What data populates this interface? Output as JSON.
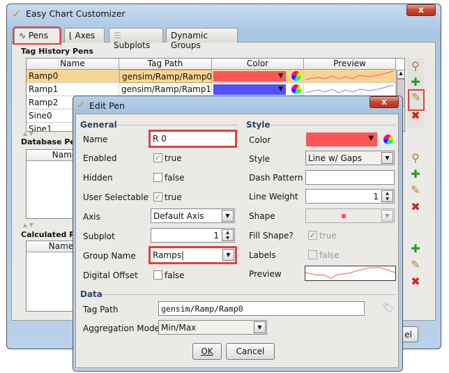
{
  "main": {
    "title": "Easy Chart Customizer",
    "close": "x",
    "tabs": [
      {
        "label": "Pens",
        "icon": "line-chart-icon"
      },
      {
        "label": "Axes",
        "icon": "axes-icon"
      },
      {
        "label": "Subplots",
        "icon": "subplots-icon"
      },
      {
        "label": "Dynamic Groups"
      }
    ],
    "tag_history": {
      "title": "Tag History Pens",
      "columns": [
        "Name",
        "Tag Path",
        "Color",
        "Preview"
      ],
      "rows": [
        {
          "name": "Ramp0",
          "path": "gensim/Ramp/Ramp0",
          "color": "#ff5555"
        },
        {
          "name": "Ramp1",
          "path": "gensim/Ramp/Ramp1",
          "color": "#5050ff"
        },
        {
          "name": "Ramp2"
        },
        {
          "name": "Sine0"
        },
        {
          "name": "Sine1"
        }
      ]
    },
    "database": {
      "title": "Database Pens",
      "columns": [
        "Name"
      ]
    },
    "calculated": {
      "title": "Calculated Pens",
      "columns": [
        "Name"
      ]
    },
    "cancel_partial": "el"
  },
  "dialog": {
    "title": "Edit Pen",
    "close": "x",
    "general": {
      "title": "General",
      "name_label": "Name",
      "name_value": "R 0",
      "enabled_label": "Enabled",
      "enabled_value": "true",
      "enabled": true,
      "hidden_label": "Hidden",
      "hidden_value": "false",
      "hidden": false,
      "selectable_label": "User Selectable",
      "selectable_value": "true",
      "selectable": true,
      "axis_label": "Axis",
      "axis_value": "Default Axis",
      "subplot_label": "Subplot",
      "subplot_value": "1",
      "group_label": "Group Name",
      "group_value": "Ramps",
      "digital_label": "Digital Offset",
      "digital_value": "false",
      "digital": false
    },
    "style": {
      "title": "Style",
      "color_label": "Color",
      "color_value": "#ff5555",
      "style_label": "Style",
      "style_value": "Line w/ Gaps",
      "dash_label": "Dash Pattern",
      "dash_value": "",
      "weight_label": "Line Weight",
      "weight_value": "1",
      "shape_label": "Shape",
      "fill_label": "Fill Shape?",
      "fill_value": "true",
      "labels_label": "Labels",
      "labels_value": "false",
      "preview_label": "Preview"
    },
    "data": {
      "title": "Data",
      "tagpath_label": "Tag Path",
      "tagpath_value": "gensim/Ramp/Ramp0",
      "agg_label": "Aggregation Mode",
      "agg_value": "Min/Max"
    },
    "ok": "OK",
    "cancel": "Cancel"
  }
}
